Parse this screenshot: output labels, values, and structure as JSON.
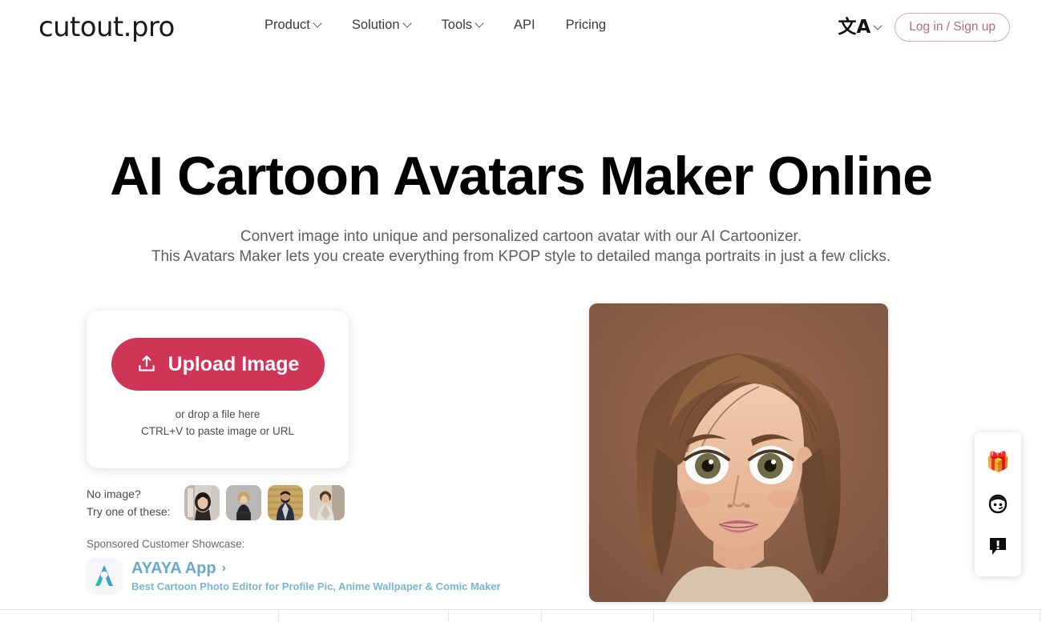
{
  "header": {
    "logo": "cutout.pro",
    "nav": [
      {
        "label": "Product",
        "has_caret": true
      },
      {
        "label": "Solution",
        "has_caret": true
      },
      {
        "label": "Tools",
        "has_caret": true
      },
      {
        "label": "API",
        "has_caret": false
      },
      {
        "label": "Pricing",
        "has_caret": false
      }
    ],
    "language_glyph": "文A",
    "login_label": "Log in / Sign up",
    "login_border_color": "#dba9b8",
    "login_text_color": "#b36b80"
  },
  "hero": {
    "title": "AI Cartoon Avatars Maker Online",
    "subtitle_line1": "Convert image into unique and personalized cartoon avatar with our AI Cartoonizer.",
    "subtitle_line2": "This Avatars Maker lets you create everything from KPOP style to detailed manga portraits in just a few clicks."
  },
  "upload": {
    "button_label": "Upload Image",
    "button_color": "#cf3556",
    "drop_line1": "or drop a file here",
    "drop_line2": "CTRL+V to paste image or URL"
  },
  "samples": {
    "label_line1": "No image?",
    "label_line2": "Try one of these:",
    "thumbnails": [
      {
        "name": "sample-woman-dark-hair"
      },
      {
        "name": "sample-woman-blonde"
      },
      {
        "name": "sample-man-beard"
      },
      {
        "name": "sample-woman-scarf"
      }
    ]
  },
  "sponsor": {
    "label": "Sponsored Customer Showcase:",
    "app_name": "AYAYA App",
    "arrow": "›",
    "description": "Best Cartoon Photo Editor for Profile Pic, Anime Wallpaper & Comic Maker",
    "title_color": "#6aa8cf",
    "desc_color": "#7bb4d6"
  },
  "result": {
    "alt": "Cartoonized portrait of a woman with brown hair and large eyes",
    "background_color": "#8d6049"
  },
  "widget": {
    "items": [
      {
        "name": "gift-icon",
        "glyph": "🎁"
      },
      {
        "name": "avatar-face-icon",
        "glyph": ""
      },
      {
        "name": "feedback-icon",
        "glyph": ""
      }
    ]
  }
}
